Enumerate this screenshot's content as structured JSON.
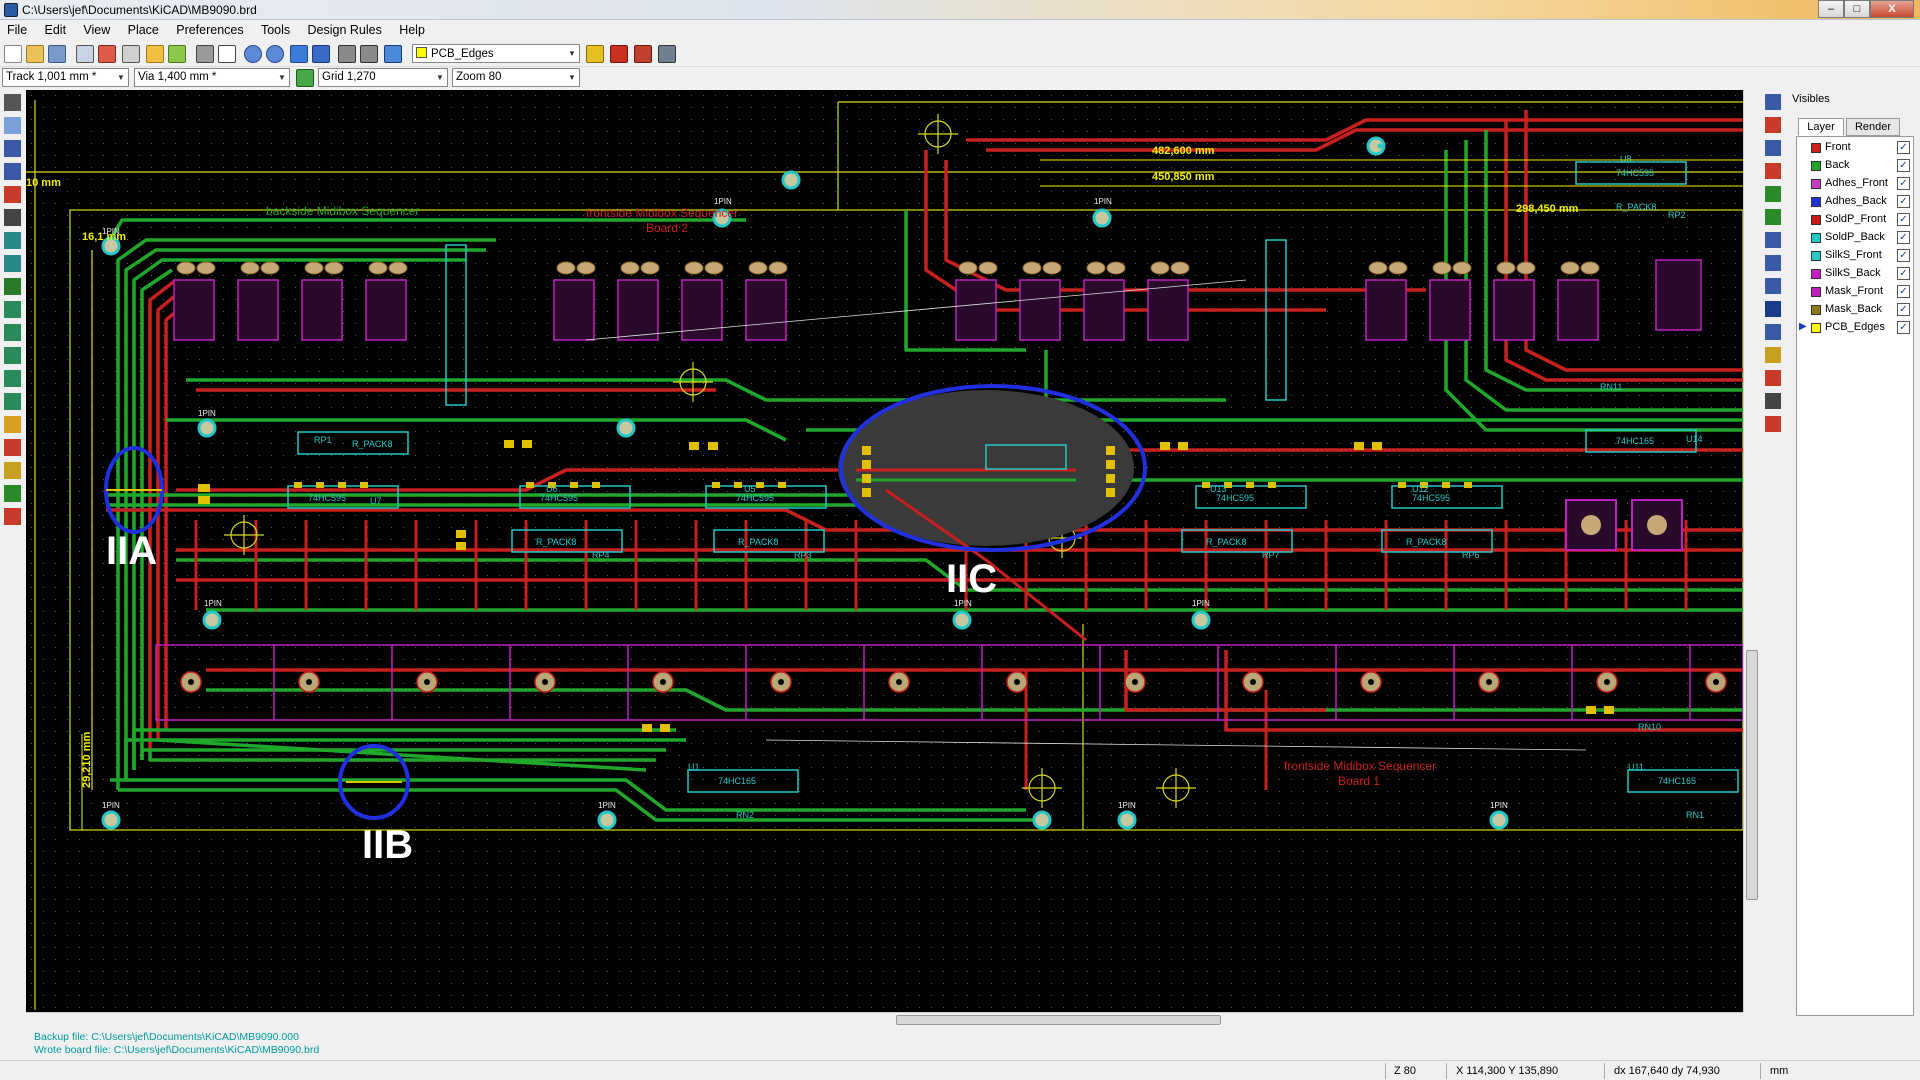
{
  "window": {
    "title": "C:\\Users\\jef\\Documents\\KiCAD\\MB9090.brd",
    "controls": {
      "minimize": "–",
      "maximize": "□",
      "close": "X"
    }
  },
  "menu": [
    "File",
    "Edit",
    "View",
    "Place",
    "Preferences",
    "Tools",
    "Design Rules",
    "Help"
  ],
  "toolbar": {
    "layer_select": "PCB_Edges",
    "track_select": "Track 1,001 mm *",
    "via_select": "Via 1,400 mm *",
    "grid_select": "Grid 1,270",
    "zoom_select": "Zoom 80"
  },
  "visibles": {
    "title": "Visibles",
    "tabs": [
      "Layer",
      "Render"
    ],
    "layers": [
      {
        "name": "Front",
        "color": "#c8201e",
        "checked": true
      },
      {
        "name": "Back",
        "color": "#1fa82a",
        "checked": true
      },
      {
        "name": "Adhes_Front",
        "color": "#c43dc4",
        "checked": true
      },
      {
        "name": "Adhes_Back",
        "color": "#1c35d4",
        "checked": true
      },
      {
        "name": "SoldP_Front",
        "color": "#c81414",
        "checked": true
      },
      {
        "name": "SoldP_Back",
        "color": "#1fc8c8",
        "checked": true
      },
      {
        "name": "SilkS_Front",
        "color": "#24c8c8",
        "checked": true
      },
      {
        "name": "SilkS_Back",
        "color": "#c81ec8",
        "checked": true
      },
      {
        "name": "Mask_Front",
        "color": "#c020c0",
        "checked": true
      },
      {
        "name": "Mask_Back",
        "color": "#8a7a1a",
        "checked": true
      },
      {
        "name": "PCB_Edges",
        "color": "#ffff00",
        "checked": true
      }
    ]
  },
  "board": {
    "annotations": [
      "IIA",
      "IIB",
      "IIC"
    ],
    "dimensions": [
      "482,600 mm",
      "450,850 mm",
      "10 mm",
      "16,1 mm",
      "298,450 mm",
      "29,210 mm"
    ],
    "texts": {
      "backside": "backside Midibox Sequencer",
      "front_board2_l1": "frontside Midibox Sequencer",
      "front_board2_l2": "Board 2",
      "front_board1_l1": "frontside Midibox Sequencer",
      "front_board1_l2": "Board 1"
    },
    "ic_labels": [
      "74HC595",
      "74HC595",
      "74HC595",
      "74HC595",
      "74HC595",
      "74HC595",
      "74HC165",
      "74HC165",
      "74HC165"
    ],
    "pack_labels": [
      "R_PACK8",
      "R_PACK8",
      "R_PACK8",
      "R_PACK8",
      "R_PACK8",
      "R_PACK8"
    ],
    "ref_labels": [
      "RP1",
      "RP4",
      "RP3",
      "RP7",
      "RP6",
      "RP2",
      "U6",
      "U5",
      "U13",
      "U12",
      "U7",
      "U8",
      "U1",
      "U11",
      "U14",
      "RN2",
      "RN1",
      "RN11",
      "RN10"
    ],
    "pin_label": "1PIN"
  },
  "messages": [
    "Backup file: C:\\Users\\jef\\Documents\\KiCAD\\MB9090.000",
    "Wrote board file: C:\\Users\\jef\\Documents\\KiCAD\\MB9090.brd"
  ],
  "status": {
    "zoom": "Z 80",
    "cursor": "X 114,300  Y 135,890",
    "delta": "dx 167,640  dy 74,930",
    "units": "mm"
  }
}
